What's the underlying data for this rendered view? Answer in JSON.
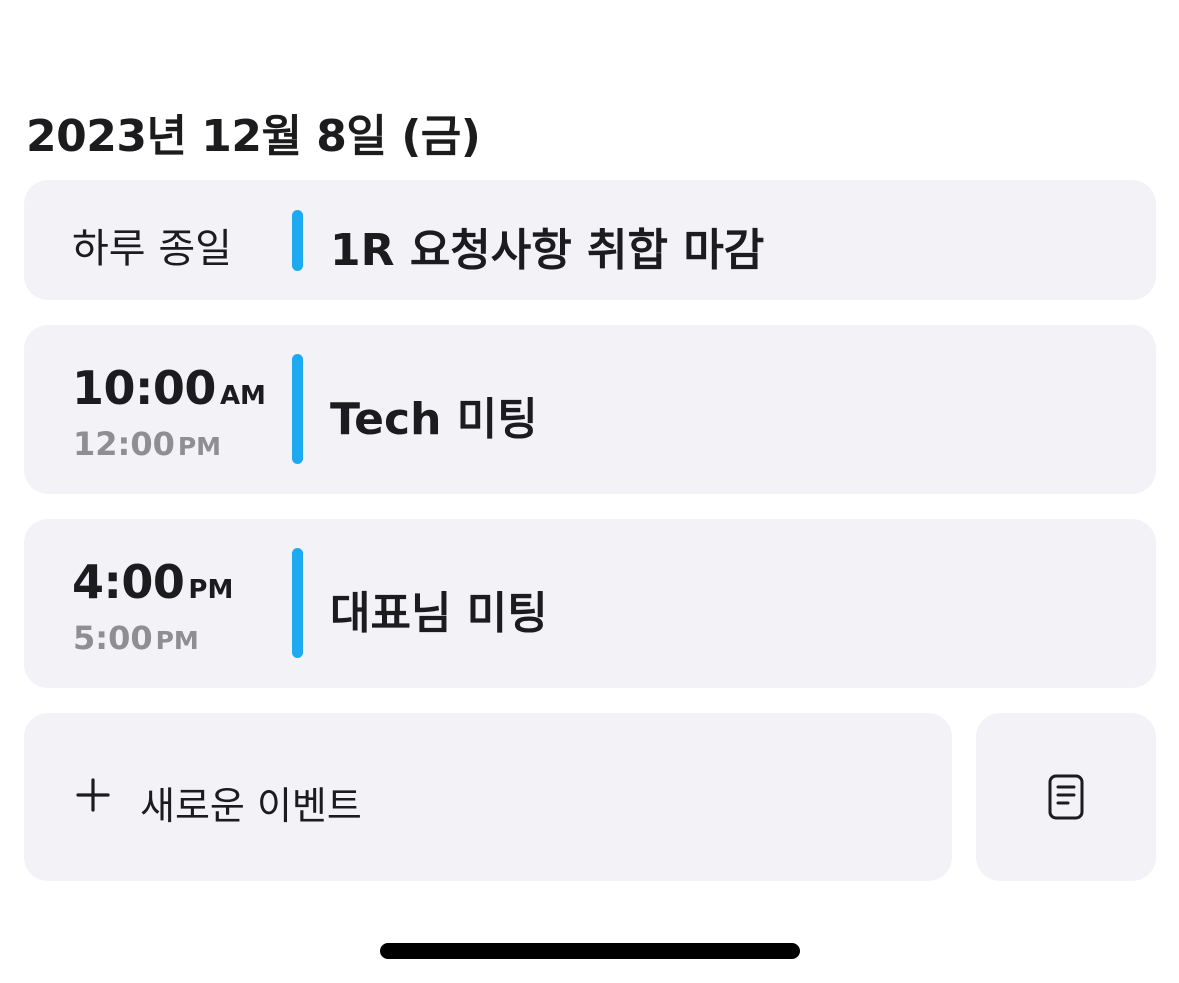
{
  "date_heading": "2023년 12월 8일 (금)",
  "colors": {
    "accent": "#1eaaf1",
    "card_background": "#f2f2f7",
    "secondary_text": "#8e8e93"
  },
  "all_day_event": {
    "label": "하루 종일",
    "title": "1R 요청사항 취합 마감"
  },
  "events": [
    {
      "start_time": "10:00",
      "start_suffix": "AM",
      "end_time": "12:00",
      "end_suffix": "PM",
      "title": "Tech 미팅"
    },
    {
      "start_time": "4:00",
      "start_suffix": "PM",
      "end_time": "5:00",
      "end_suffix": "PM",
      "title": "대표님 미팅"
    }
  ],
  "actions": {
    "new_event_label": "새로운 이벤트",
    "new_event_icon": "plus-icon",
    "notes_icon": "notes-document-icon"
  }
}
